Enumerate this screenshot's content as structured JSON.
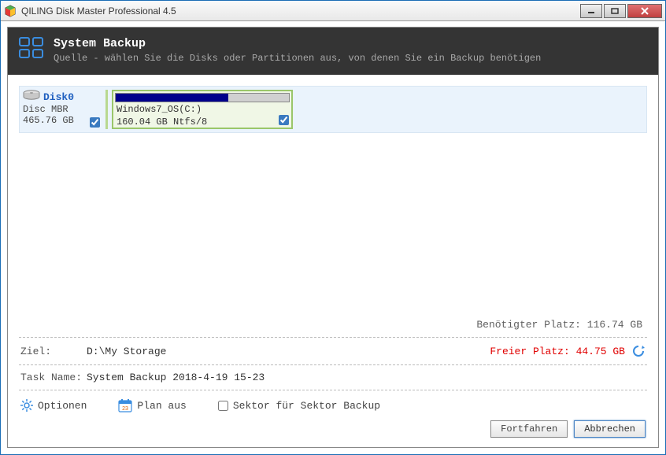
{
  "window": {
    "title": "QILING Disk Master Professional 4.5"
  },
  "header": {
    "title": "System Backup",
    "subtitle": "Quelle - wählen Sie die Disks oder Partitionen aus, von denen Sie ein Backup benötigen"
  },
  "disk": {
    "name": "Disk0",
    "type": "Disc MBR",
    "size": "465.76 GB",
    "checked": true
  },
  "partition": {
    "label": "Windows7_OS(C:)",
    "info": "160.04 GB Ntfs/8",
    "usage_pct": 65,
    "checked": true
  },
  "required_space": {
    "label": "Benötigter Platz:",
    "value": "116.74 GB"
  },
  "dest": {
    "label": "Ziel:",
    "path": "D:\\My Storage",
    "free_label": "Freier Platz:",
    "free_value": "44.75 GB"
  },
  "task": {
    "label": "Task Name:",
    "name": "System Backup 2018-4-19 15-23"
  },
  "options": {
    "optionen": "Optionen",
    "plan": "Plan aus",
    "sector": "Sektor für Sektor Backup",
    "sector_checked": false
  },
  "buttons": {
    "continue": "Fortfahren",
    "cancel": "Abbrechen"
  }
}
